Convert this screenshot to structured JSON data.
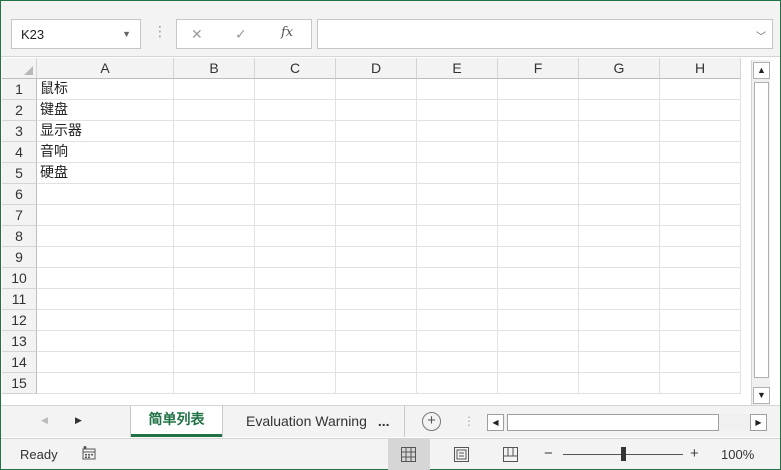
{
  "formula_bar": {
    "name_box": "K23",
    "cancel_glyph": "✕",
    "enter_glyph": "✓",
    "fx_glyph": "fx",
    "formula_value": ""
  },
  "grid": {
    "columns": [
      "A",
      "B",
      "C",
      "D",
      "E",
      "F",
      "G",
      "H"
    ],
    "rows": [
      "1",
      "2",
      "3",
      "4",
      "5",
      "6",
      "7",
      "8",
      "9",
      "10",
      "11",
      "12",
      "13",
      "14",
      "15"
    ],
    "column_a_values": [
      "鼠标",
      "键盘",
      "显示器",
      "音响",
      "硬盘"
    ]
  },
  "sheets": {
    "active": "简单列表",
    "other": "Evaluation Warning",
    "overflow": "..."
  },
  "status": {
    "ready": "Ready",
    "zoom": "100%",
    "minus": "−",
    "plus": "+"
  },
  "colors": {
    "accent": "#217346",
    "chrome": "#f3f3f3",
    "gridline": "#e1e1e1"
  },
  "icons": {
    "name_box_dropdown": "chevron-down-icon",
    "add_sheet": "plus-circle-icon",
    "macro": "macro-record-icon",
    "normal_view": "grid-view-icon",
    "page_layout": "page-layout-icon",
    "page_break": "page-break-icon"
  }
}
